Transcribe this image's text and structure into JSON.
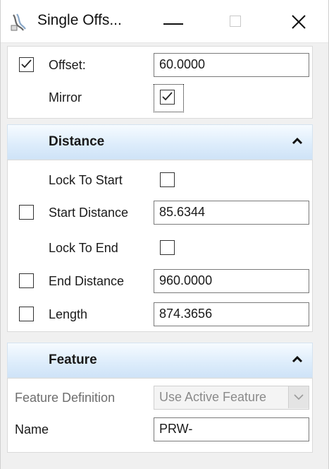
{
  "window": {
    "title": "Single Offs...",
    "icon": "offset-tool-icon"
  },
  "offset_panel": {
    "offset": {
      "label": "Offset:",
      "checked": true,
      "value": "60.0000"
    },
    "mirror": {
      "label": "Mirror",
      "checked": true
    }
  },
  "distance": {
    "header": "Distance",
    "lock_to_start": {
      "label": "Lock To Start",
      "checked": false
    },
    "start_distance": {
      "label": "Start Distance",
      "checked": false,
      "value": "85.6344"
    },
    "lock_to_end": {
      "label": "Lock To End",
      "checked": false
    },
    "end_distance": {
      "label": "End Distance",
      "checked": false,
      "value": "960.0000"
    },
    "length": {
      "label": "Length",
      "checked": false,
      "value": "874.3656"
    }
  },
  "feature": {
    "header": "Feature",
    "definition": {
      "label": "Feature Definition",
      "value": "Use Active Feature"
    },
    "name": {
      "label": "Name",
      "value": "PRW-"
    }
  },
  "colors": {
    "header_gradient_top": "#f6fbff",
    "header_gradient_bottom": "#cfe3f7",
    "panel_bg": "#ffffff",
    "window_bg": "#f0f0f0"
  }
}
